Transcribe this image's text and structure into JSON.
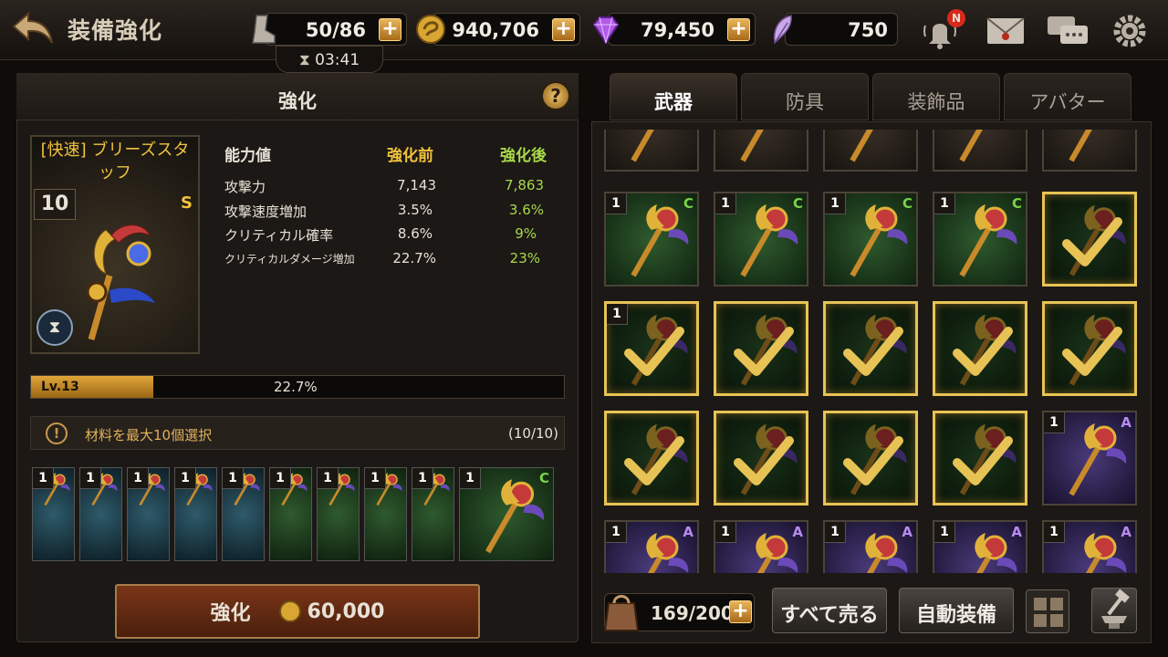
{
  "header": {
    "title": "装備強化",
    "stamina": "50/86",
    "gold": "940,706",
    "gems": "79,450",
    "tickets": "750",
    "timer": "03:41",
    "notification_badge": "N"
  },
  "panel": {
    "title": "強化",
    "help": "?"
  },
  "item": {
    "name": "[快速] ブリーズスタッフ",
    "level": "10",
    "grade": "S"
  },
  "stats": {
    "header": {
      "label": "能力値",
      "before": "強化前",
      "after": "強化後"
    },
    "rows": [
      {
        "label": "攻撃力",
        "before": "7,143",
        "after": "7,863"
      },
      {
        "label": "攻撃速度増加",
        "before": "3.5%",
        "after": "3.6%"
      },
      {
        "label": "クリティカル確率",
        "before": "8.6%",
        "after": "9%"
      },
      {
        "label": "クリティカルダメージ増加",
        "before": "22.7%",
        "after": "23%"
      }
    ]
  },
  "level_bar": {
    "level": "Lv.13",
    "percent_text": "22.7%",
    "fill_ratio": 0.23
  },
  "materials": {
    "info": "材料を最大10個選択",
    "count": "(10/10)",
    "slots": [
      {
        "qty": "1",
        "grade": "",
        "theme": "blue"
      },
      {
        "qty": "1",
        "grade": "",
        "theme": "blue"
      },
      {
        "qty": "1",
        "grade": "",
        "theme": "blue"
      },
      {
        "qty": "1",
        "grade": "",
        "theme": "blue"
      },
      {
        "qty": "1",
        "grade": "",
        "theme": "blue"
      },
      {
        "qty": "1",
        "grade": "",
        "theme": "green"
      },
      {
        "qty": "1",
        "grade": "",
        "theme": "green"
      },
      {
        "qty": "1",
        "grade": "",
        "theme": "green"
      },
      {
        "qty": "1",
        "grade": "",
        "theme": "green"
      },
      {
        "qty": "1",
        "grade": "C",
        "theme": "green"
      }
    ]
  },
  "enhance_button": {
    "label": "強化",
    "cost": "60,000"
  },
  "tabs": [
    "武器",
    "防具",
    "装飾品",
    "アバター"
  ],
  "inventory": {
    "rows": [
      [
        {
          "qty": "",
          "grade": "",
          "theme": "brown",
          "selected": false
        },
        {
          "qty": "",
          "grade": "",
          "theme": "brown",
          "selected": false
        },
        {
          "qty": "",
          "grade": "",
          "theme": "brown",
          "selected": false
        },
        {
          "qty": "",
          "grade": "",
          "theme": "brown",
          "selected": false
        },
        {
          "qty": "",
          "grade": "",
          "theme": "brown",
          "selected": false
        }
      ],
      [
        {
          "qty": "1",
          "grade": "C",
          "theme": "green",
          "selected": false
        },
        {
          "qty": "1",
          "grade": "C",
          "theme": "green",
          "selected": false
        },
        {
          "qty": "1",
          "grade": "C",
          "theme": "green",
          "selected": false
        },
        {
          "qty": "1",
          "grade": "C",
          "theme": "green",
          "selected": false
        },
        {
          "qty": "",
          "grade": "",
          "theme": "green",
          "selected": true
        }
      ],
      [
        {
          "qty": "1",
          "grade": "",
          "theme": "green",
          "selected": true
        },
        {
          "qty": "",
          "grade": "",
          "theme": "green",
          "selected": true
        },
        {
          "qty": "",
          "grade": "",
          "theme": "green",
          "selected": true
        },
        {
          "qty": "",
          "grade": "",
          "theme": "green",
          "selected": true
        },
        {
          "qty": "",
          "grade": "",
          "theme": "green",
          "selected": true
        }
      ],
      [
        {
          "qty": "",
          "grade": "",
          "theme": "green",
          "selected": true
        },
        {
          "qty": "",
          "grade": "",
          "theme": "green",
          "selected": true
        },
        {
          "qty": "",
          "grade": "",
          "theme": "green",
          "selected": true
        },
        {
          "qty": "",
          "grade": "",
          "theme": "green",
          "selected": true
        },
        {
          "qty": "1",
          "grade": "A",
          "theme": "purple",
          "selected": false
        }
      ],
      [
        {
          "qty": "1",
          "grade": "A",
          "theme": "purple",
          "selected": false
        },
        {
          "qty": "1",
          "grade": "A",
          "theme": "purple",
          "selected": false
        },
        {
          "qty": "1",
          "grade": "A",
          "theme": "purple",
          "selected": false
        },
        {
          "qty": "1",
          "grade": "A",
          "theme": "purple",
          "selected": false
        },
        {
          "qty": "1",
          "grade": "A",
          "theme": "purple",
          "selected": false
        }
      ]
    ]
  },
  "footer": {
    "bag": "169/200",
    "sell_all": "すべて売る",
    "auto_equip": "自動装備"
  },
  "colors": {
    "gold": "#f2c33e",
    "green_after": "#a8d84a",
    "grade_c": "#7ad34a",
    "grade_a": "#b88af0",
    "selected": "#e7c355"
  }
}
